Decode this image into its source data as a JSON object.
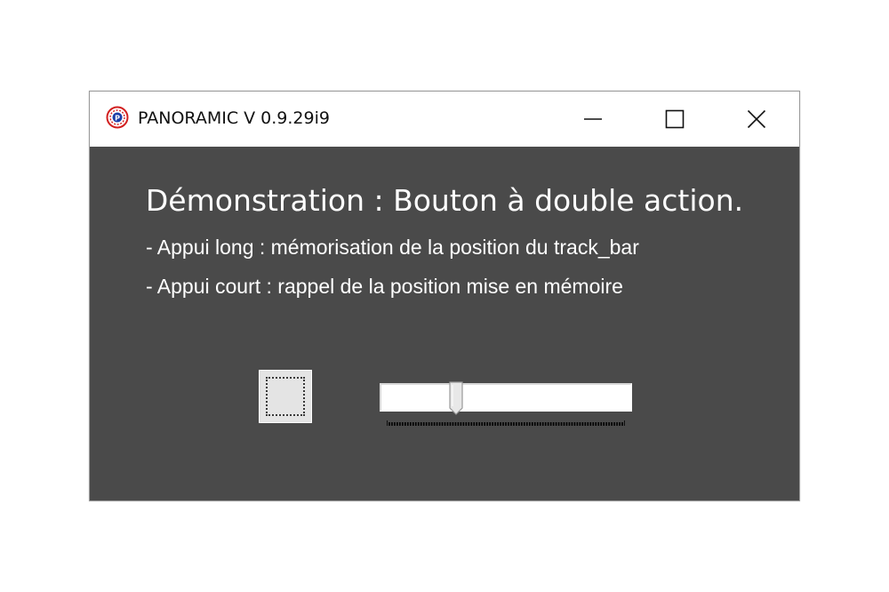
{
  "window": {
    "title": "PANORAMIC V 0.9.29i9",
    "icon": "panoramic-app-icon",
    "controls": {
      "minimize_icon": "minimize-icon",
      "maximize_icon": "maximize-icon",
      "close_icon": "close-icon"
    }
  },
  "content": {
    "heading": "Démonstration : Bouton à double action.",
    "lines": [
      "- Appui long : mémorisation de la position du track_bar",
      "- Appui court : rappel de la position mise en mémoire"
    ]
  },
  "trackbar": {
    "position_fraction": 0.29
  },
  "colors": {
    "background": "#4a4a4a",
    "text": "#ffffff",
    "titlebar": "#ffffff"
  }
}
